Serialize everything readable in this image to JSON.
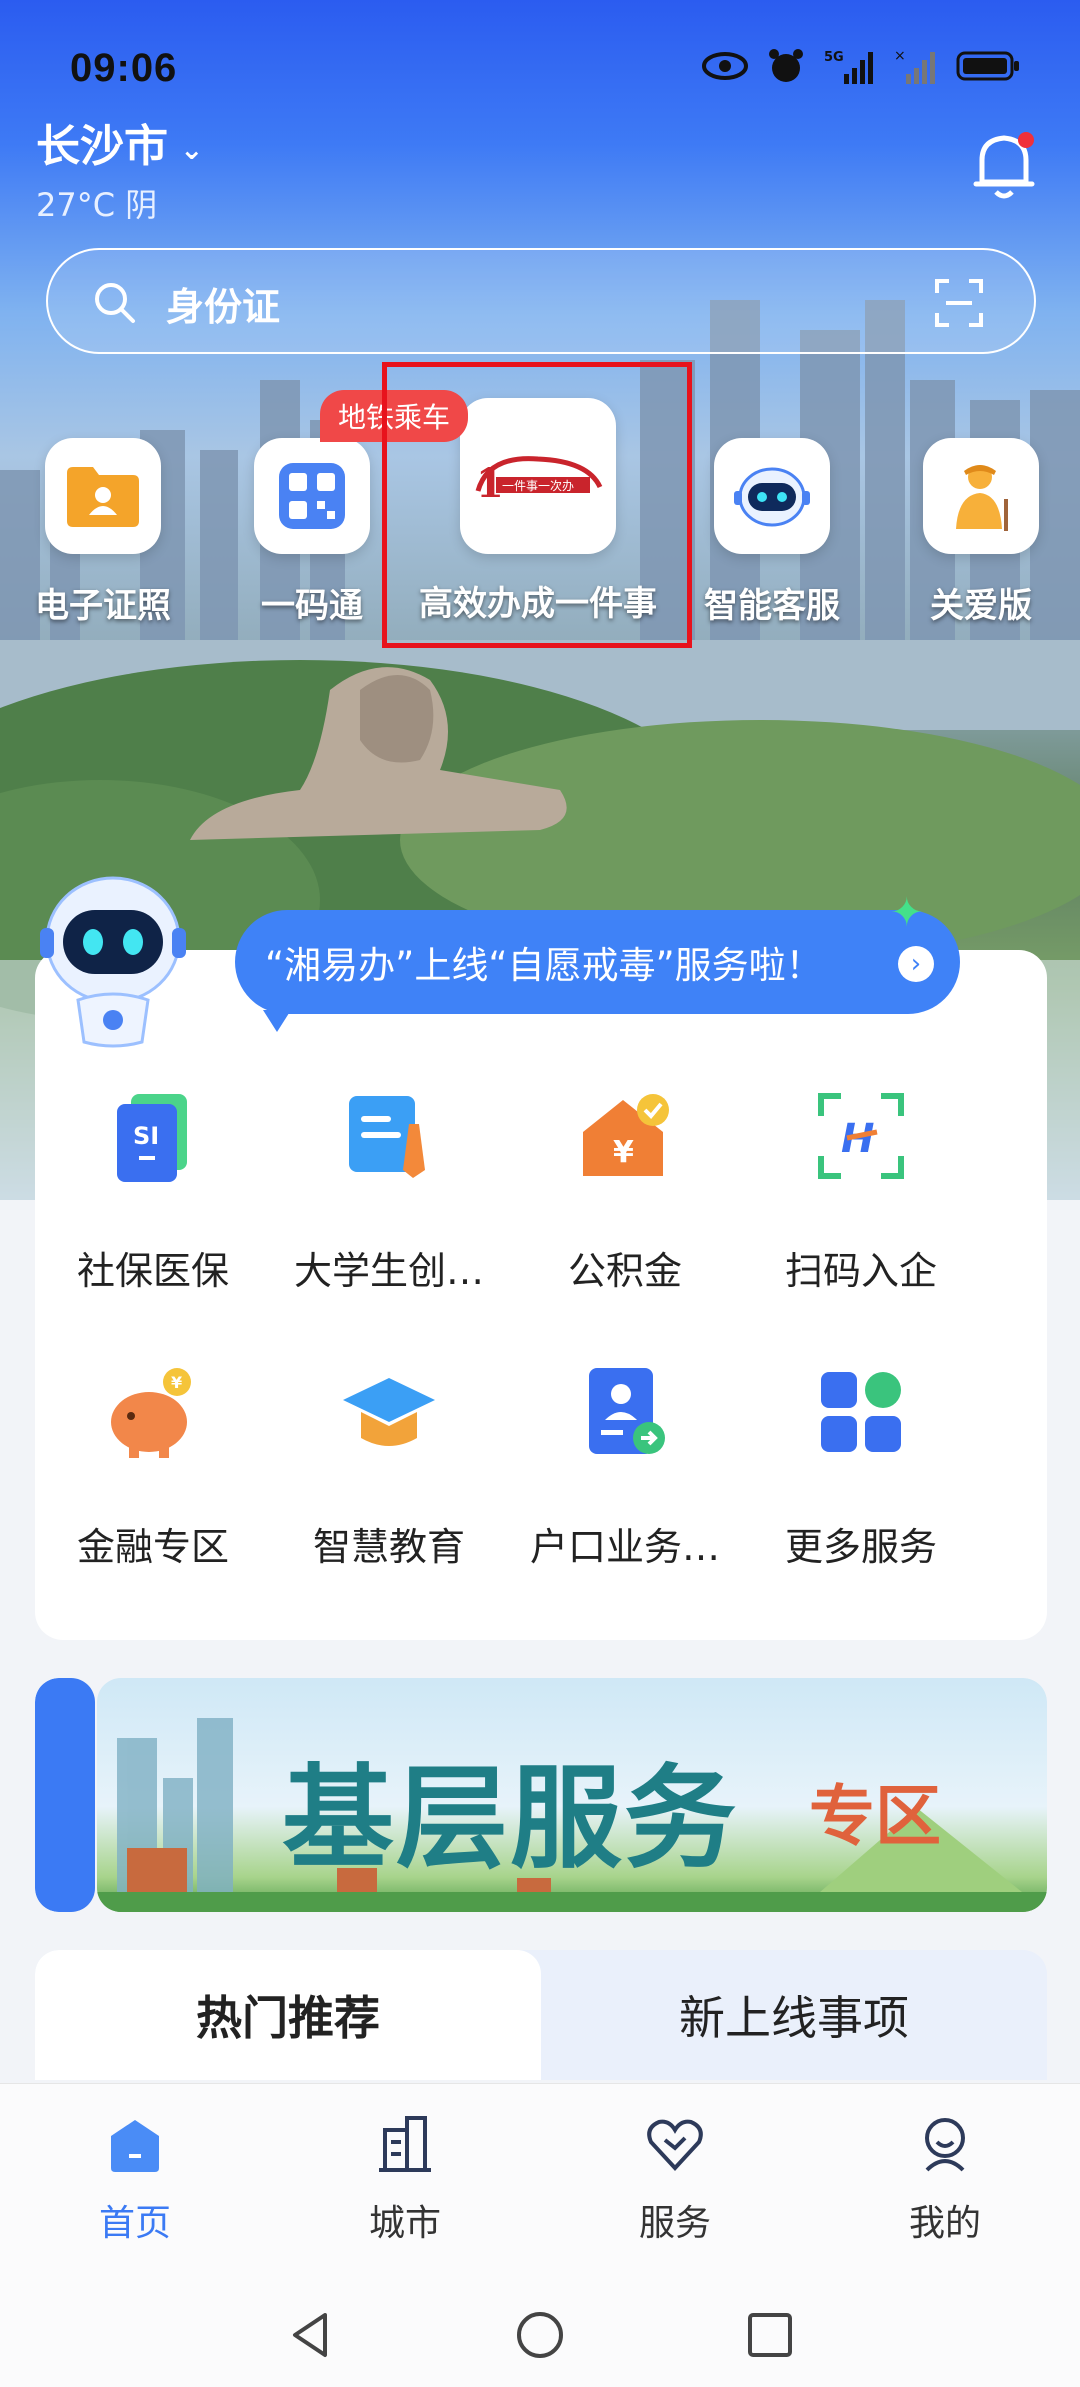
{
  "status_bar": {
    "time": "09:06"
  },
  "header": {
    "city": "长沙市",
    "weather": "27°C 阴"
  },
  "search": {
    "placeholder": "身份证"
  },
  "quick_access": [
    {
      "label": "电子证照",
      "icon": "folder-id-icon"
    },
    {
      "label": "一码通",
      "icon": "qr-code-icon"
    },
    {
      "label": "高效办成一件事",
      "icon": "one-thing-logo-icon",
      "badge": "地铁乘车"
    },
    {
      "label": "智能客服",
      "icon": "robot-icon"
    },
    {
      "label": "关爱版",
      "icon": "elder-care-icon"
    }
  ],
  "announcement": "“湘易办”上线“自愿戒毒”服务啦！",
  "services": [
    {
      "label": "社保医保",
      "icon": "social-security-icon"
    },
    {
      "label": "大学生创…",
      "icon": "student-startup-icon"
    },
    {
      "label": "公积金",
      "icon": "housing-fund-icon"
    },
    {
      "label": "扫码入企",
      "icon": "scan-enterprise-icon"
    },
    {
      "label": "金融专区",
      "icon": "piggy-bank-icon"
    },
    {
      "label": "智慧教育",
      "icon": "graduation-cap-icon"
    },
    {
      "label": "户口业务…",
      "icon": "household-registration-icon"
    },
    {
      "label": "更多服务",
      "icon": "more-grid-icon"
    }
  ],
  "banner": {
    "title": "基层服务",
    "subtitle": "专区"
  },
  "tabs": [
    {
      "label": "热门推荐",
      "active": true
    },
    {
      "label": "新上线事项",
      "active": false
    }
  ],
  "bottom_nav": [
    {
      "label": "首页",
      "icon": "home-icon",
      "active": true
    },
    {
      "label": "城市",
      "icon": "city-building-icon",
      "active": false
    },
    {
      "label": "服务",
      "icon": "service-heart-icon",
      "active": false
    },
    {
      "label": "我的",
      "icon": "profile-icon",
      "active": false
    }
  ],
  "colors": {
    "accent": "#3b7af4",
    "highlight_box": "#e8121c",
    "badge": "#f04848"
  }
}
